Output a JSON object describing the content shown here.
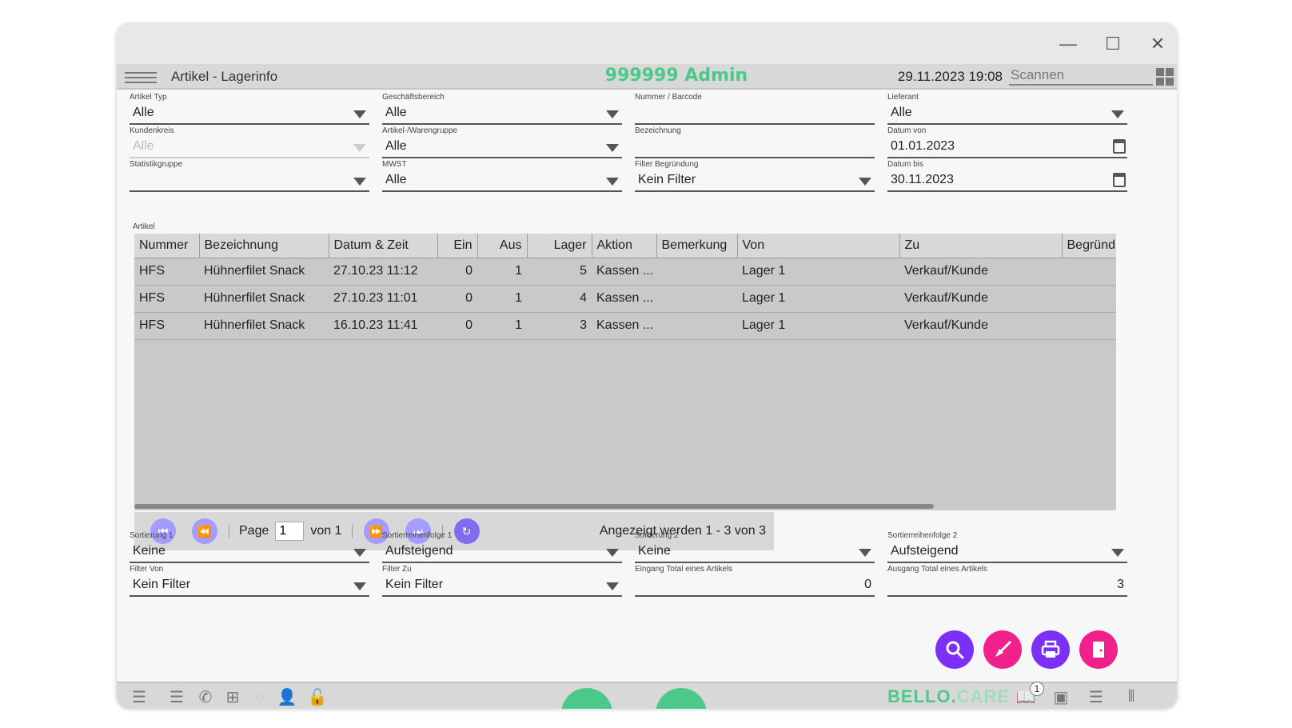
{
  "window": {
    "minimize": "—",
    "maximize": "☐",
    "close": "✕"
  },
  "header": {
    "title": "Artikel - Lagerinfo",
    "user": "999999 Admin",
    "datetime": "29.11.2023 19:08",
    "scan_placeholder": "Scannen"
  },
  "filters": {
    "artikel_typ": {
      "label": "Artikel Typ",
      "value": "Alle"
    },
    "geschaeftsbereich": {
      "label": "Geschäftsbereich",
      "value": "Alle"
    },
    "nummer": {
      "label": "Nummer / Barcode",
      "value": ""
    },
    "lieferant": {
      "label": "Lieferant",
      "value": "Alle"
    },
    "kundenkreis": {
      "label": "Kundenkreis",
      "value": "Alle"
    },
    "warengruppe": {
      "label": "Artikel-/Warengruppe",
      "value": "Alle"
    },
    "bezeichnung": {
      "label": "Bezeichnung",
      "value": ""
    },
    "datum_von": {
      "label": "Datum von",
      "value": "01.01.2023"
    },
    "statistikgruppe": {
      "label": "Statistikgruppe",
      "value": ""
    },
    "mwst": {
      "label": "MWST",
      "value": "Alle"
    },
    "filter_begruendung": {
      "label": "Filter Begründung",
      "value": "Kein Filter"
    },
    "datum_bis": {
      "label": "Datum bis",
      "value": "30.11.2023"
    }
  },
  "table": {
    "section_label": "Artikel",
    "columns": [
      "Nummer",
      "Bezeichnung",
      "Datum & Zeit",
      "Ein",
      "Aus",
      "Lager",
      "Aktion",
      "Bemerkung",
      "Von",
      "Zu",
      "Begründ"
    ],
    "rows": [
      [
        "HFS",
        "Hühnerfilet Snack",
        "27.10.23 11:12",
        "0",
        "1",
        "5",
        "Kassen ...",
        "",
        "Lager 1",
        "Verkauf/Kunde",
        ""
      ],
      [
        "HFS",
        "Hühnerfilet Snack",
        "27.10.23 11:01",
        "0",
        "1",
        "4",
        "Kassen ...",
        "",
        "Lager 1",
        "Verkauf/Kunde",
        ""
      ],
      [
        "HFS",
        "Hühnerfilet Snack",
        "16.10.23 11:41",
        "0",
        "1",
        "3",
        "Kassen ...",
        "",
        "Lager 1",
        "Verkauf/Kunde",
        ""
      ]
    ]
  },
  "pager": {
    "page_label": "Page",
    "page_value": "1",
    "of_label": "von 1",
    "info": "Angezeigt werden 1 - 3 von 3"
  },
  "sort": {
    "sortierung1": {
      "label": "Sortierung 1",
      "value": "Keine"
    },
    "reihenfolge1": {
      "label": "Sortierreihenfolge 1",
      "value": "Aufsteigend"
    },
    "sortierung2": {
      "label": "Sortierung 2",
      "value": "Keine"
    },
    "reihenfolge2": {
      "label": "Sortierreihenfolge 2",
      "value": "Aufsteigend"
    },
    "filter_von": {
      "label": "Filter Von",
      "value": "Kein Filter"
    },
    "filter_zu": {
      "label": "Filter Zu",
      "value": "Kein Filter"
    },
    "eingang_total": {
      "label": "Eingang Total eines Artikels",
      "value": "0"
    },
    "ausgang_total": {
      "label": "Ausgang Total eines Artikels",
      "value": "3"
    }
  },
  "actions": {
    "search_color": "#7b2ff7",
    "clear_color": "#f0208c",
    "print_color": "#7b2ff7",
    "exit_color": "#f0208c"
  },
  "footer": {
    "brand_bold": "BELLO.",
    "brand_light": "CARE",
    "badge": "1",
    "accent": "#4cc98a"
  }
}
